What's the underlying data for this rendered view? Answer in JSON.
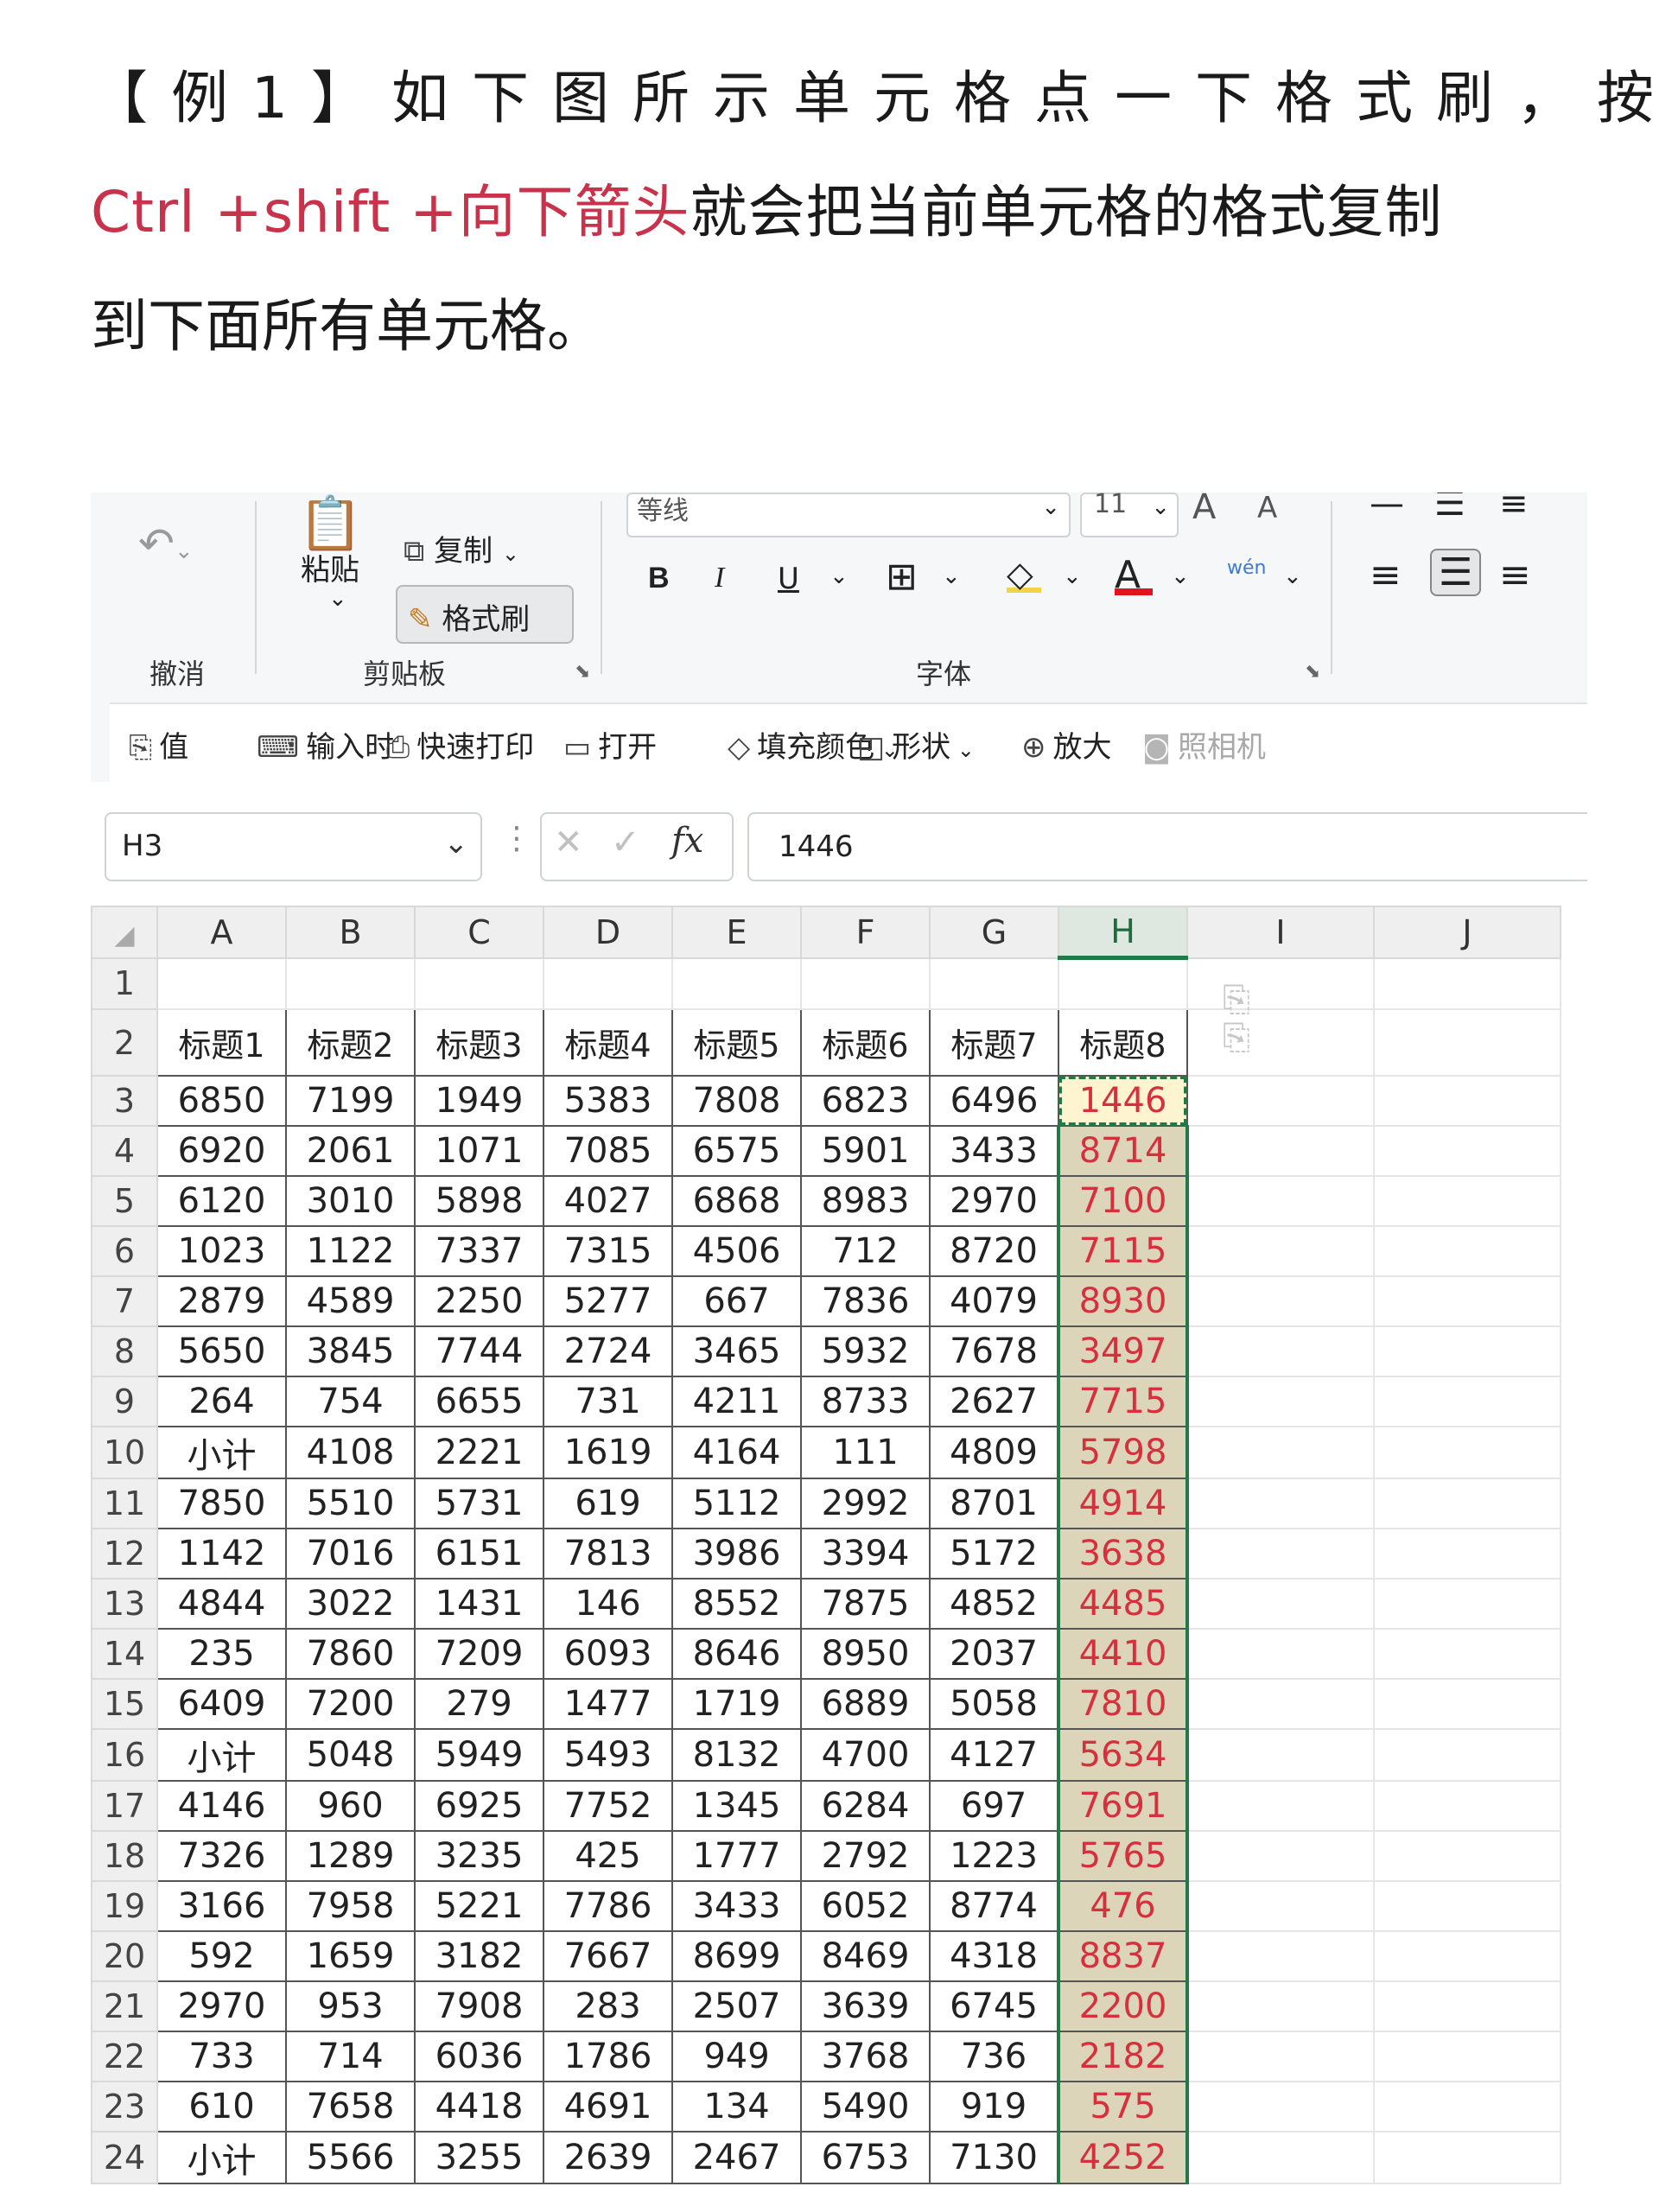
{
  "article": {
    "line1": "【例1】如下图所示单元格点一下格式刷，按",
    "line2_red": "Ctrl +shift +向下箭头",
    "line2_rest": "就会把当前单元格的格式复制",
    "line3": "到下面所有单元格。"
  },
  "ribbon": {
    "undo_label": "撤消",
    "paste_label": "粘贴",
    "copy_label": "复制",
    "format_painter_label": "格式刷",
    "clipboard_group": "剪贴板",
    "font_name": "等线",
    "font_size": "11",
    "font_group": "字体",
    "bold": "B",
    "italic": "I",
    "underline": "U",
    "font_color_glyph": "A",
    "phonetic": "wén",
    "grow": "A",
    "shrink": "A"
  },
  "quick_toolbar": [
    {
      "label": "值",
      "icon": "paste-values-icon"
    },
    {
      "label": "输入时",
      "icon": "input-icon"
    },
    {
      "label": "快速打印",
      "icon": "quick-print-icon"
    },
    {
      "label": "打开",
      "icon": "folder-open-icon"
    },
    {
      "label": "填充颜色",
      "icon": "fill-color-icon"
    },
    {
      "label": "形状",
      "icon": "shapes-icon"
    },
    {
      "label": "放大",
      "icon": "zoom-in-icon"
    },
    {
      "label": "照相机",
      "icon": "camera-icon"
    }
  ],
  "formula_bar": {
    "name_box": "H3",
    "fx": "fx",
    "value": "1446"
  },
  "sheet": {
    "columns": [
      "A",
      "B",
      "C",
      "D",
      "E",
      "F",
      "G",
      "H",
      "I",
      "J"
    ],
    "selected_column": "H",
    "headers": [
      "标题1",
      "标题2",
      "标题3",
      "标题4",
      "标题5",
      "标题6",
      "标题7",
      "标题8"
    ],
    "rows": [
      {
        "n": "3",
        "cells": [
          "6850",
          "7199",
          "1949",
          "5383",
          "7808",
          "6823",
          "6496",
          "1446"
        ]
      },
      {
        "n": "4",
        "cells": [
          "6920",
          "2061",
          "1071",
          "7085",
          "6575",
          "5901",
          "3433",
          "8714"
        ]
      },
      {
        "n": "5",
        "cells": [
          "6120",
          "3010",
          "5898",
          "4027",
          "6868",
          "8983",
          "2970",
          "7100"
        ]
      },
      {
        "n": "6",
        "cells": [
          "1023",
          "1122",
          "7337",
          "7315",
          "4506",
          "712",
          "8720",
          "7115"
        ]
      },
      {
        "n": "7",
        "cells": [
          "2879",
          "4589",
          "2250",
          "5277",
          "667",
          "7836",
          "4079",
          "8930"
        ]
      },
      {
        "n": "8",
        "cells": [
          "5650",
          "3845",
          "7744",
          "2724",
          "3465",
          "5932",
          "7678",
          "3497"
        ]
      },
      {
        "n": "9",
        "cells": [
          "264",
          "754",
          "6655",
          "731",
          "4211",
          "8733",
          "2627",
          "7715"
        ]
      },
      {
        "n": "10",
        "cells": [
          "小计",
          "4108",
          "2221",
          "1619",
          "4164",
          "111",
          "4809",
          "5798"
        ]
      },
      {
        "n": "11",
        "cells": [
          "7850",
          "5510",
          "5731",
          "619",
          "5112",
          "2992",
          "8701",
          "4914"
        ]
      },
      {
        "n": "12",
        "cells": [
          "1142",
          "7016",
          "6151",
          "7813",
          "3986",
          "3394",
          "5172",
          "3638"
        ]
      },
      {
        "n": "13",
        "cells": [
          "4844",
          "3022",
          "1431",
          "146",
          "8552",
          "7875",
          "4852",
          "4485"
        ]
      },
      {
        "n": "14",
        "cells": [
          "235",
          "7860",
          "7209",
          "6093",
          "8646",
          "8950",
          "2037",
          "4410"
        ]
      },
      {
        "n": "15",
        "cells": [
          "6409",
          "7200",
          "279",
          "1477",
          "1719",
          "6889",
          "5058",
          "7810"
        ]
      },
      {
        "n": "16",
        "cells": [
          "小计",
          "5048",
          "5949",
          "5493",
          "8132",
          "4700",
          "4127",
          "5634"
        ]
      },
      {
        "n": "17",
        "cells": [
          "4146",
          "960",
          "6925",
          "7752",
          "1345",
          "6284",
          "697",
          "7691"
        ]
      },
      {
        "n": "18",
        "cells": [
          "7326",
          "1289",
          "3235",
          "425",
          "1777",
          "2792",
          "1223",
          "5765"
        ]
      },
      {
        "n": "19",
        "cells": [
          "3166",
          "7958",
          "5221",
          "7786",
          "3433",
          "6052",
          "8774",
          "476"
        ]
      },
      {
        "n": "20",
        "cells": [
          "592",
          "1659",
          "3182",
          "7667",
          "8699",
          "8469",
          "4318",
          "8837"
        ]
      },
      {
        "n": "21",
        "cells": [
          "2970",
          "953",
          "7908",
          "283",
          "2507",
          "3639",
          "6745",
          "2200"
        ]
      },
      {
        "n": "22",
        "cells": [
          "733",
          "714",
          "6036",
          "1786",
          "949",
          "3768",
          "736",
          "2182"
        ]
      },
      {
        "n": "23",
        "cells": [
          "610",
          "7658",
          "4418",
          "4691",
          "134",
          "5490",
          "919",
          "575"
        ]
      },
      {
        "n": "24",
        "cells": [
          "小计",
          "5566",
          "3255",
          "2639",
          "2467",
          "6753",
          "7130",
          "4252"
        ]
      }
    ]
  },
  "colors": {
    "accent_red": "#c8324a",
    "selection_green": "#1f7a45",
    "highlight_fill": "#dcd5ba",
    "cell_red_text": "#d6303d"
  }
}
